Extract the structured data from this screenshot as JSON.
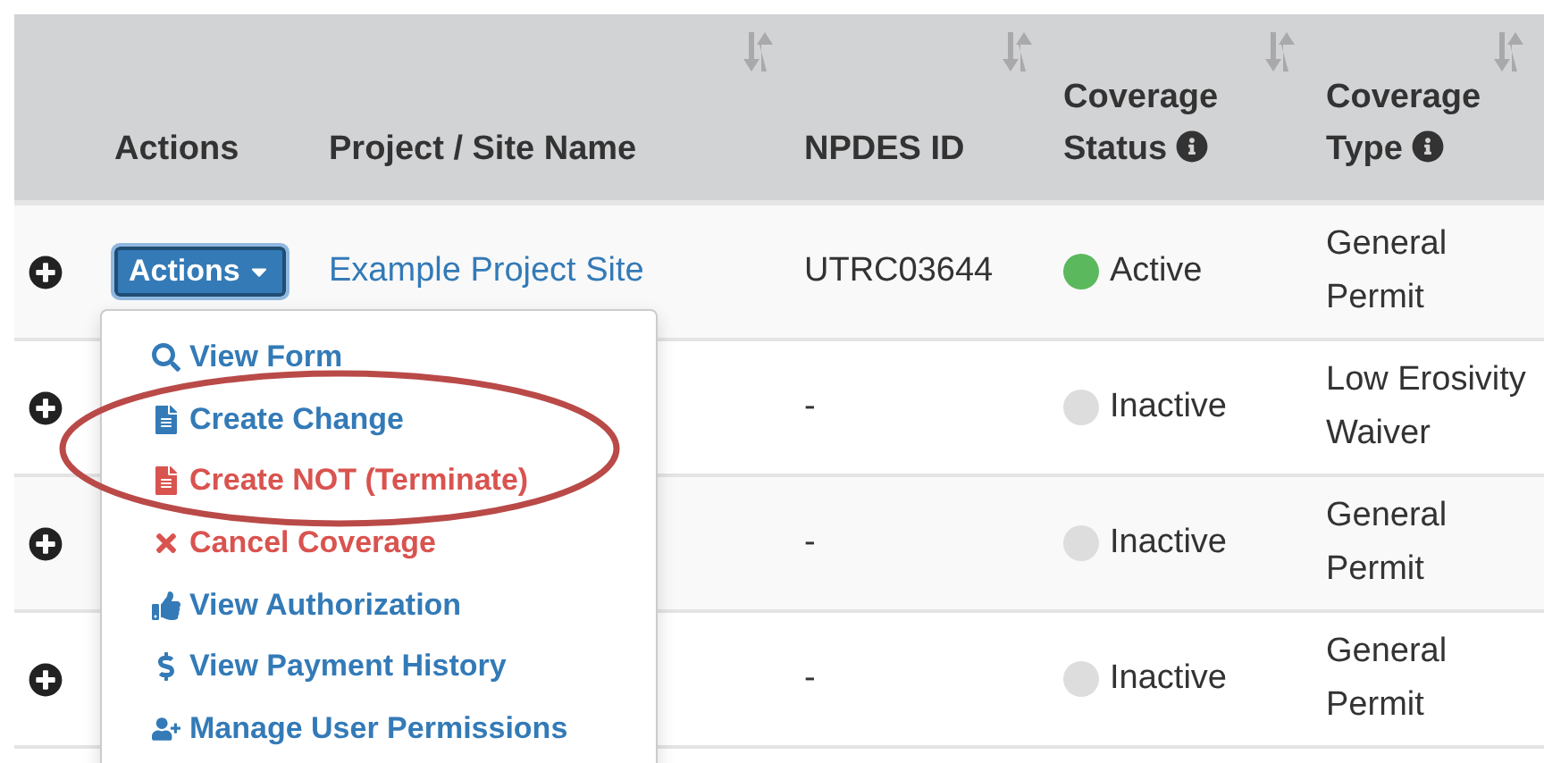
{
  "table": {
    "columns": [
      {
        "label": "Actions",
        "sortable": false,
        "info": false
      },
      {
        "label": "Project / Site Name",
        "sortable": true,
        "info": false
      },
      {
        "label": "NPDES ID",
        "sortable": true,
        "info": false
      },
      {
        "label": "Coverage Status",
        "sortable": true,
        "info": true
      },
      {
        "label": "Coverage Type",
        "sortable": true,
        "info": true
      }
    ],
    "rows": [
      {
        "action": "Actions",
        "name": "Example Project Site",
        "npdes": "UTRC03644",
        "status": "Active",
        "color": "#5cb85c",
        "type": "General Permit"
      },
      {
        "npdes": "-",
        "status": "Inactive",
        "color": "#dddddd",
        "type": "Low Erosivity Waiver"
      },
      {
        "npdes": "-",
        "status": "Inactive",
        "color": "#dddddd",
        "type": "General Permit"
      },
      {
        "npdes": "-",
        "status": "Inactive",
        "color": "#dddddd",
        "type": "General Permit"
      }
    ]
  },
  "menu": {
    "items": [
      {
        "label": "View Form",
        "kind": "search",
        "danger": false
      },
      {
        "label": "Create Change",
        "kind": "file",
        "danger": false
      },
      {
        "label": "Create NOT (Terminate)",
        "kind": "file",
        "danger": true
      },
      {
        "label": "Cancel Coverage",
        "kind": "cross",
        "danger": true
      },
      {
        "label": "View Authorization",
        "kind": "thumb",
        "danger": false
      },
      {
        "label": "View Payment History",
        "kind": "dollar",
        "danger": false
      },
      {
        "label": "Manage User Permissions",
        "kind": "user-plus",
        "danger": false
      }
    ]
  },
  "annotation": {
    "kind": "ellipse",
    "color": "#b94a48"
  }
}
